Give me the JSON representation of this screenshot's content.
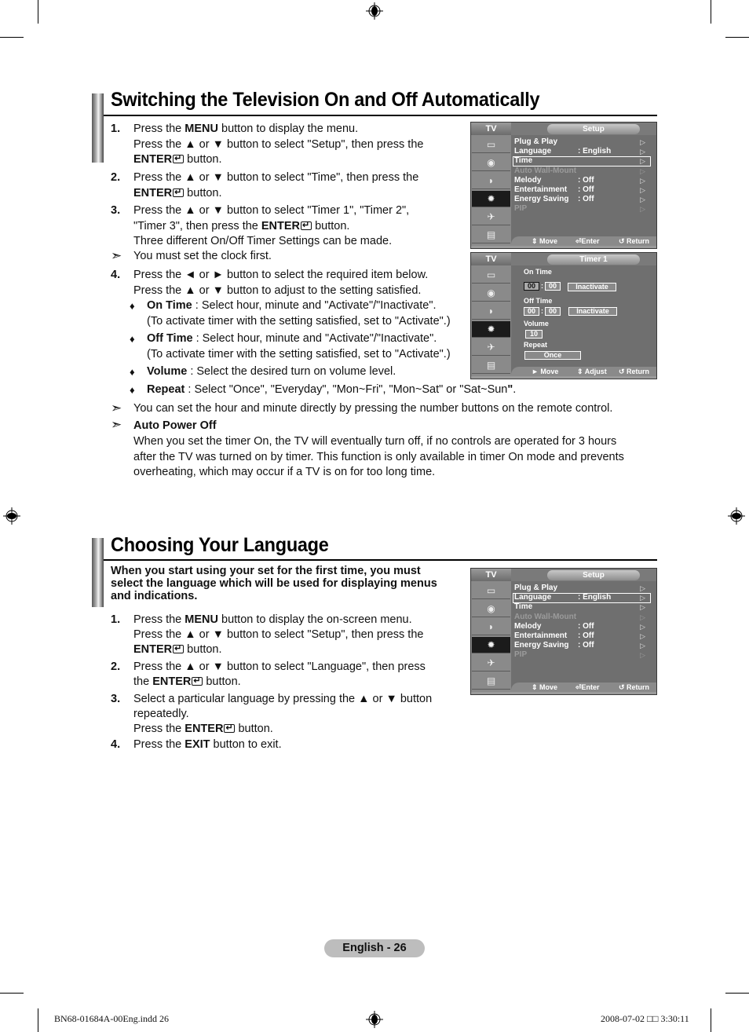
{
  "section1": {
    "title": "Switching the Television On and Off Automatically",
    "steps": [
      {
        "num": "1.",
        "lines": [
          [
            {
              "t": "Press the "
            },
            {
              "b": "MENU"
            },
            {
              "t": " button to display the menu."
            }
          ],
          [
            {
              "t": "Press the ▲ or ▼ button to select \"Setup\", then press the"
            }
          ],
          [
            {
              "b": "ENTER"
            },
            {
              "icon": "enter"
            },
            {
              "t": " button."
            }
          ]
        ]
      },
      {
        "num": "2.",
        "lines": [
          [
            {
              "t": "Press the ▲ or ▼ button to select \"Time\", then press the"
            }
          ],
          [
            {
              "b": "ENTER"
            },
            {
              "icon": "enter"
            },
            {
              "t": " button."
            }
          ]
        ]
      },
      {
        "num": "3.",
        "lines": [
          [
            {
              "t": "Press the ▲ or ▼ button to select \"Timer 1\", \"Timer 2\","
            }
          ],
          [
            {
              "t": "\"Timer 3\", then press the "
            },
            {
              "b": "ENTER"
            },
            {
              "icon": "enter"
            },
            {
              "t": " button."
            }
          ],
          [
            {
              "t": "Three different On/Off Timer Settings can be made."
            }
          ]
        ]
      }
    ],
    "note_clock": "You must set the clock first.",
    "step4": {
      "num": "4.",
      "lines": [
        [
          {
            "t": "Press the ◄ or ► button to select the required item below."
          }
        ],
        [
          {
            "t": "Press the ▲ or ▼ button to adjust to the setting satisfied."
          }
        ]
      ]
    },
    "bullets": [
      {
        "lines": [
          [
            {
              "b": "On Time"
            },
            {
              "t": " : Select hour, minute and \"Activate\"/\"Inactivate\"."
            }
          ],
          [
            {
              "t": "(To activate timer with the setting satisfied, set to \"Activate\".)"
            }
          ]
        ]
      },
      {
        "lines": [
          [
            {
              "b": "Off Time"
            },
            {
              "t": " : Select hour, minute and \"Activate\"/\"Inactivate\"."
            }
          ],
          [
            {
              "t": "(To activate timer with the setting satisfied, set to \"Activate\".)"
            }
          ]
        ]
      },
      {
        "lines": [
          [
            {
              "b": "Volume"
            },
            {
              "t": " : Select the desired turn on volume level."
            }
          ]
        ]
      },
      {
        "lines": [
          [
            {
              "b": "Repeat"
            },
            {
              "t": " : Select \"Once\", \"Everyday\", \"Mon~Fri\", \"Mon~Sat\" or \"Sat~Sun"
            },
            {
              "b": "\""
            },
            {
              "t": "."
            }
          ]
        ]
      }
    ],
    "note_number": "You can set the hour and minute directly by pressing the number buttons on the remote control.",
    "auto_power_off": {
      "title": "Auto Power Off",
      "lines": [
        "When you set the timer On, the TV will eventually turn off, if no controls are operated for 3 hours",
        "after the TV was turned on by timer. This function is only available in timer On mode and prevents",
        "overheating, which may occur if a TV is on for too long time."
      ]
    }
  },
  "section2": {
    "title": "Choosing Your Language",
    "intro": [
      "When you start using your set for the first time, you must",
      "select the language which will be used for displaying menus",
      "and indications."
    ],
    "steps": [
      {
        "num": "1.",
        "lines": [
          [
            {
              "t": "Press the "
            },
            {
              "b": "MENU"
            },
            {
              "t": " button to display the on-screen menu."
            }
          ],
          [
            {
              "t": "Press the ▲ or ▼ button to select \"Setup\", then press the"
            }
          ],
          [
            {
              "b": "ENTER"
            },
            {
              "icon": "enter"
            },
            {
              "t": " button."
            }
          ]
        ]
      },
      {
        "num": "2.",
        "lines": [
          [
            {
              "t": "Press the ▲ or ▼ button to select \"Language\", then press"
            }
          ],
          [
            {
              "t": "the "
            },
            {
              "b": "ENTER"
            },
            {
              "icon": "enter"
            },
            {
              "t": " button."
            }
          ]
        ]
      },
      {
        "num": "3.",
        "lines": [
          [
            {
              "t": "Select a particular language by pressing the ▲ or ▼ button"
            }
          ],
          [
            {
              "t": "repeatedly."
            }
          ],
          [
            {
              "t": "Press the "
            },
            {
              "b": "ENTER"
            },
            {
              "icon": "enter"
            },
            {
              "t": " button."
            }
          ]
        ]
      },
      {
        "num": "4.",
        "lines": [
          [
            {
              "t": "Press the "
            },
            {
              "b": "EXIT"
            },
            {
              "t": " button to exit."
            }
          ]
        ]
      }
    ]
  },
  "osd_setup_time": {
    "tv_label": "TV",
    "title": "Setup",
    "rows": [
      {
        "label": "Plug & Play",
        "value": "",
        "dim": false
      },
      {
        "label": "Language",
        "value": ": English",
        "dim": false
      },
      {
        "label": "Time",
        "value": "",
        "dim": false
      },
      {
        "label": "Auto Wall-Mount",
        "value": "",
        "dim": true
      },
      {
        "label": "Melody",
        "value": ": Off",
        "dim": false
      },
      {
        "label": "Entertainment",
        "value": ": Off",
        "dim": false
      },
      {
        "label": "Energy Saving",
        "value": ": Off",
        "dim": false
      },
      {
        "label": "PIP",
        "value": "",
        "dim": true
      }
    ],
    "highlighted": "Time",
    "footer": {
      "move": "Move",
      "enter": "Enter",
      "return": "Return"
    }
  },
  "osd_timer": {
    "tv_label": "TV",
    "title": "Timer 1",
    "on_time_label": "On Time",
    "on_hour": "00",
    "on_minute": "00",
    "on_state": "Inactivate",
    "off_time_label": "Off Time",
    "off_hour": "00",
    "off_minute": "00",
    "off_state": "Inactivate",
    "volume_label": "Volume",
    "volume_value": "10",
    "repeat_label": "Repeat",
    "repeat_value": "Once",
    "separator": ":",
    "footer": {
      "move": "Move",
      "adjust": "Adjust",
      "return": "Return"
    }
  },
  "osd_setup_language": {
    "tv_label": "TV",
    "title": "Setup",
    "rows": [
      {
        "label": "Plug & Play",
        "value": "",
        "dim": false
      },
      {
        "label": "Language",
        "value": ": English",
        "dim": false
      },
      {
        "label": "Time",
        "value": "",
        "dim": false
      },
      {
        "label": "Auto Wall-Mount",
        "value": "",
        "dim": true
      },
      {
        "label": "Melody",
        "value": ": Off",
        "dim": false
      },
      {
        "label": "Entertainment",
        "value": ": Off",
        "dim": false
      },
      {
        "label": "Energy Saving",
        "value": ": Off",
        "dim": false
      },
      {
        "label": "PIP",
        "value": "",
        "dim": true
      }
    ],
    "highlighted": "Language",
    "footer": {
      "move": "Move",
      "enter": "Enter",
      "return": "Return"
    }
  },
  "footer": {
    "page_label": "English - 26",
    "slug_file": "BN68-01684A-00Eng.indd   26",
    "slug_date": "2008-07-02   □□ 3:30:11"
  },
  "icons": {
    "note_arrow": "➣",
    "bullet": "♦",
    "row_arrow": "▷",
    "osd_side": [
      "picture-icon",
      "sound-icon",
      "channel-icon",
      "setup-gear-icon",
      "input-icon",
      "digital-icon"
    ]
  }
}
